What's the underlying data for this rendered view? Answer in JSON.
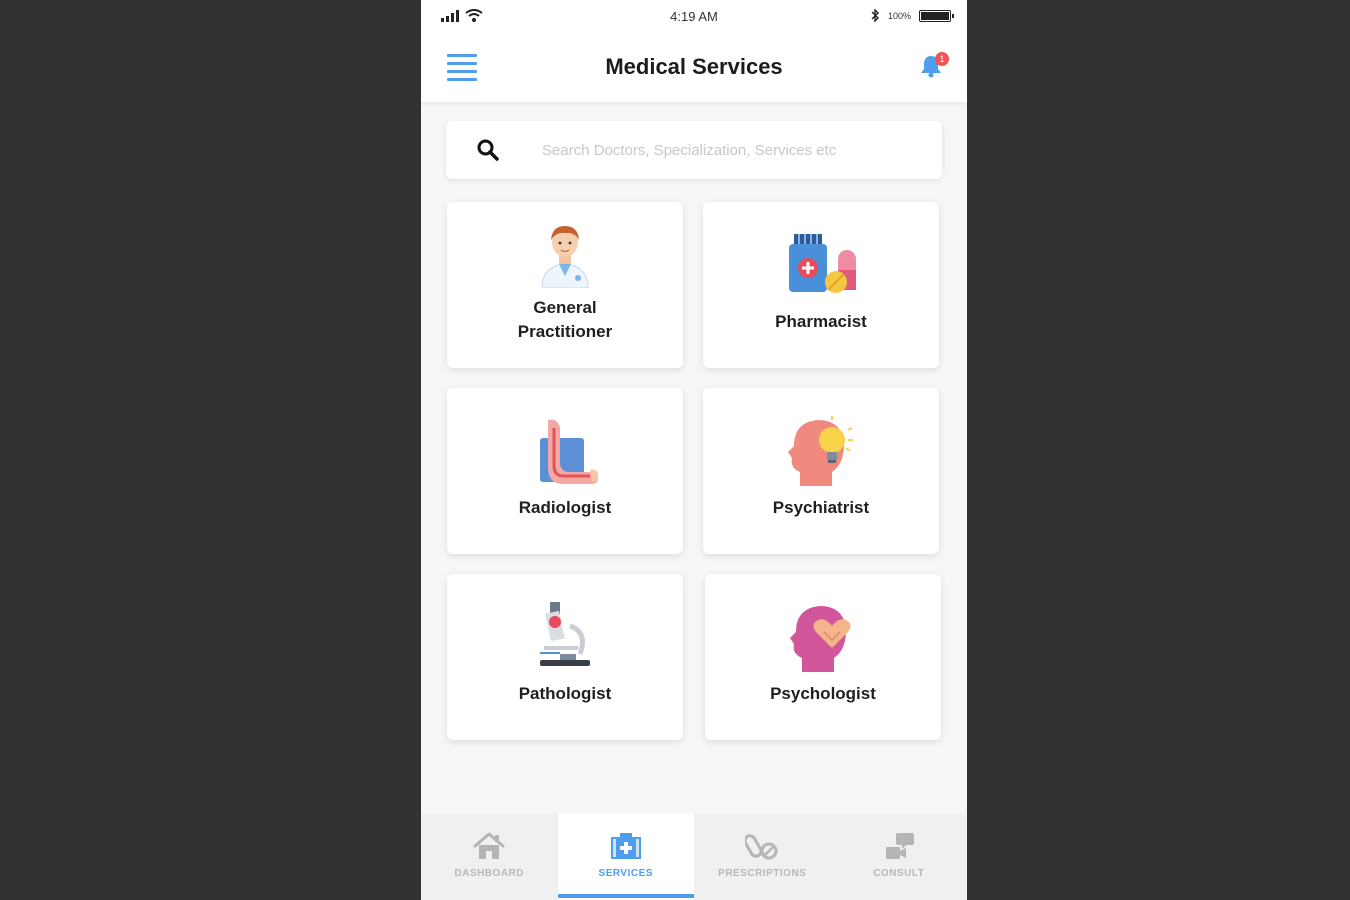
{
  "status_bar": {
    "time": "4:19 AM",
    "battery_text": "100%",
    "battery_level": 1.0
  },
  "header": {
    "title": "Medical Services",
    "notification_count": "1"
  },
  "search": {
    "placeholder": "Search Doctors, Specialization, Services etc"
  },
  "services": [
    {
      "label_line1": "General",
      "label_line2": "Practitioner",
      "icon": "doctor-icon"
    },
    {
      "label_line1": "Pharmacist",
      "label_line2": "",
      "icon": "medicine-icon"
    },
    {
      "label_line1": "Radiologist",
      "label_line2": "",
      "icon": "xray-arm-icon"
    },
    {
      "label_line1": "Psychiatrist",
      "label_line2": "",
      "icon": "head-lightbulb-icon"
    },
    {
      "label_line1": "Pathologist",
      "label_line2": "",
      "icon": "microscope-icon"
    },
    {
      "label_line1": "Psychologist",
      "label_line2": "",
      "icon": "head-heart-icon"
    }
  ],
  "bottom_nav": [
    {
      "label": "DASHBOARD",
      "icon": "home-icon",
      "active": false
    },
    {
      "label": "SERVICES",
      "icon": "medical-kit-icon",
      "active": true
    },
    {
      "label": "PRESCRIPTIONS",
      "icon": "pills-icon",
      "active": false
    },
    {
      "label": "CONSULT",
      "icon": "consult-icon",
      "active": false
    }
  ],
  "colors": {
    "accent": "#4f9ded",
    "background": "#323232",
    "badge": "#f25454"
  }
}
